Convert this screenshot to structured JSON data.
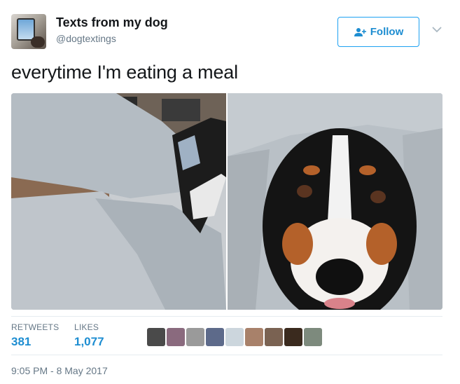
{
  "user": {
    "name": "Texts from my dog",
    "handle": "@dogtextings"
  },
  "follow": {
    "label": "Follow"
  },
  "tweet": {
    "text": "everytime I'm eating a meal",
    "timestamp": "9:05 PM - 8 May 2017"
  },
  "stats": {
    "retweets_label": "RETWEETS",
    "retweets_value": "381",
    "likes_label": "LIKES",
    "likes_value": "1,077"
  },
  "likers": [
    {
      "color": "#4a4a4a"
    },
    {
      "color": "#8a6a7e"
    },
    {
      "color": "#9a9a9a"
    },
    {
      "color": "#5d6a8a"
    },
    {
      "color": "#ccd6dd"
    },
    {
      "color": "#a8816a"
    },
    {
      "color": "#7a6252"
    },
    {
      "color": "#3a2a1e"
    },
    {
      "color": "#7d8a7d"
    }
  ],
  "colors": {
    "accent": "#1da1f2",
    "link": "#1d8dd1",
    "muted": "#657786",
    "divider": "#e6ecf0"
  },
  "icons": [
    "user-plus-icon",
    "chevron-down-icon"
  ]
}
